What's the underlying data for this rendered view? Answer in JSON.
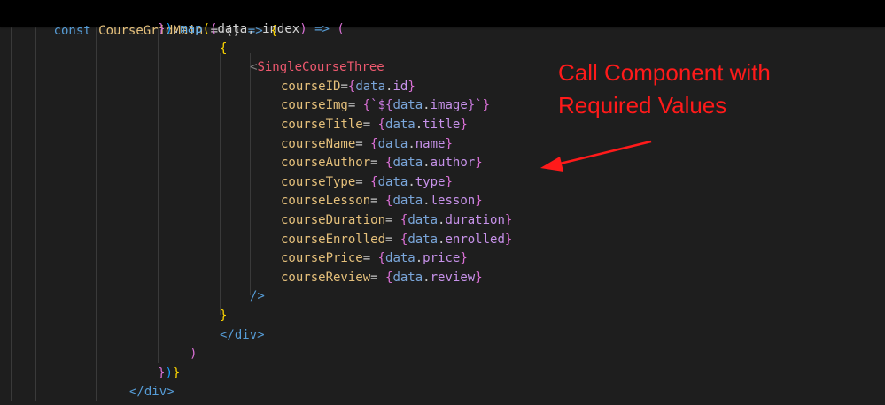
{
  "editor": {
    "sticky_line": {
      "keyword": "const",
      "name": "CourseGridMain",
      "rest_1": " = () ",
      "arrow": "=>",
      "brace": "{"
    },
    "lines": [
      {
        "t": [
          [
            "}",
            "b2"
          ],
          [
            ")",
            "b3"
          ],
          [
            ".",
            "op"
          ],
          [
            "map",
            "fn"
          ],
          [
            "(",
            "b1"
          ],
          [
            "(",
            "b2"
          ],
          [
            "data",
            "var"
          ],
          [
            ", ",
            "op"
          ],
          [
            "index",
            "var"
          ],
          [
            ")",
            "b2"
          ],
          [
            " => ",
            "kw"
          ],
          [
            "(",
            "b2"
          ]
        ]
      },
      {
        "t": [
          [
            "{",
            "b1"
          ]
        ]
      },
      {
        "t": [
          [
            "<",
            "tag"
          ],
          [
            "SingleCourseThree",
            "comp"
          ]
        ]
      },
      {
        "t": [
          [
            "courseID",
            "attr"
          ],
          [
            "=",
            "op"
          ],
          [
            "{",
            "b2"
          ],
          [
            "data",
            "data"
          ],
          [
            ".",
            "op"
          ],
          [
            "id",
            "prop"
          ],
          [
            "}",
            "b2"
          ]
        ]
      },
      {
        "t": [
          [
            "courseImg",
            "attr"
          ],
          [
            "= ",
            "op"
          ],
          [
            "{",
            "b2"
          ],
          [
            "`",
            "tpl"
          ],
          [
            "${",
            "tpl"
          ],
          [
            "data",
            "data"
          ],
          [
            ".",
            "op"
          ],
          [
            "image",
            "prop"
          ],
          [
            "}",
            "tpl"
          ],
          [
            "`",
            "tpl"
          ],
          [
            "}",
            "b2"
          ]
        ]
      },
      {
        "t": [
          [
            "courseTitle",
            "attr"
          ],
          [
            "= ",
            "op"
          ],
          [
            "{",
            "b2"
          ],
          [
            "data",
            "data"
          ],
          [
            ".",
            "op"
          ],
          [
            "title",
            "prop"
          ],
          [
            "}",
            "b2"
          ]
        ]
      },
      {
        "t": [
          [
            "courseName",
            "attr"
          ],
          [
            "= ",
            "op"
          ],
          [
            "{",
            "b2"
          ],
          [
            "data",
            "data"
          ],
          [
            ".",
            "op"
          ],
          [
            "name",
            "prop"
          ],
          [
            "}",
            "b2"
          ]
        ]
      },
      {
        "t": [
          [
            "courseAuthor",
            "attr"
          ],
          [
            "= ",
            "op"
          ],
          [
            "{",
            "b2"
          ],
          [
            "data",
            "data"
          ],
          [
            ".",
            "op"
          ],
          [
            "author",
            "prop"
          ],
          [
            "}",
            "b2"
          ]
        ]
      },
      {
        "t": [
          [
            "courseType",
            "attr"
          ],
          [
            "= ",
            "op"
          ],
          [
            "{",
            "b2"
          ],
          [
            "data",
            "data"
          ],
          [
            ".",
            "op"
          ],
          [
            "type",
            "prop"
          ],
          [
            "}",
            "b2"
          ]
        ]
      },
      {
        "t": [
          [
            "courseLesson",
            "attr"
          ],
          [
            "= ",
            "op"
          ],
          [
            "{",
            "b2"
          ],
          [
            "data",
            "data"
          ],
          [
            ".",
            "op"
          ],
          [
            "lesson",
            "prop"
          ],
          [
            "}",
            "b2"
          ]
        ]
      },
      {
        "t": [
          [
            "courseDuration",
            "attr"
          ],
          [
            "= ",
            "op"
          ],
          [
            "{",
            "b2"
          ],
          [
            "data",
            "data"
          ],
          [
            ".",
            "op"
          ],
          [
            "duration",
            "prop"
          ],
          [
            "}",
            "b2"
          ]
        ]
      },
      {
        "t": [
          [
            "courseEnrolled",
            "attr"
          ],
          [
            "= ",
            "op"
          ],
          [
            "{",
            "b2"
          ],
          [
            "data",
            "data"
          ],
          [
            ".",
            "op"
          ],
          [
            "enrolled",
            "prop"
          ],
          [
            "}",
            "b2"
          ]
        ]
      },
      {
        "t": [
          [
            "coursePrice",
            "attr"
          ],
          [
            "= ",
            "op"
          ],
          [
            "{",
            "b2"
          ],
          [
            "data",
            "data"
          ],
          [
            ".",
            "op"
          ],
          [
            "price",
            "prop"
          ],
          [
            "}",
            "b2"
          ]
        ]
      },
      {
        "t": [
          [
            "courseReview",
            "attr"
          ],
          [
            "= ",
            "op"
          ],
          [
            "{",
            "b2"
          ],
          [
            "data",
            "data"
          ],
          [
            ".",
            "op"
          ],
          [
            "review",
            "prop"
          ],
          [
            "}",
            "b2"
          ]
        ]
      },
      {
        "t": [
          [
            "/>",
            "kw"
          ]
        ]
      },
      {
        "t": [
          [
            "}",
            "b1"
          ]
        ]
      },
      {
        "t": [
          [
            "</div>",
            "kw"
          ]
        ]
      },
      {
        "t": [
          [
            ")",
            "b2"
          ]
        ]
      },
      {
        "t": [
          [
            "}",
            "b2"
          ],
          [
            ")",
            "b3"
          ],
          [
            "}",
            "b1"
          ]
        ]
      },
      {
        "t": [
          [
            "</div>",
            "kw"
          ]
        ]
      }
    ]
  },
  "annotation": {
    "line1": "Call Component with",
    "line2": "Required Values",
    "color": "#ff1a1a"
  },
  "colors": {
    "background": "#1e1e1e",
    "sticky_background": "#000000"
  }
}
